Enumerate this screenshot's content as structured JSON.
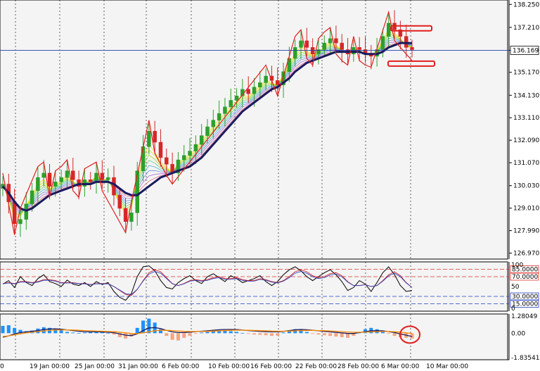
{
  "colors": {
    "background": "#ffffff",
    "pane": "#f4f4f4",
    "grid": "#000000",
    "axis": "#000000",
    "candle_up": "#2ca02c",
    "candle_down": "#d62728",
    "zigzag": "#e0201e",
    "main_ma": "#1a1a5e",
    "price_line": "#1f3fa8",
    "price_label_bg": "#ffffff",
    "stoch_main": "#000000",
    "stoch_signal_a": "#d0202a",
    "stoch_signal_b": "#2040c0",
    "level_red": "#e03030",
    "level_blue": "#2040c0",
    "macd_pos": "#1e90ff",
    "macd_neg": "#f4a582",
    "macd_line": "#1a1a5e",
    "macd_signal": "#ff8c00",
    "annotation": "#e0201e"
  },
  "chart_data": [
    {
      "type": "line",
      "panel": "price",
      "y_ticks": [
        "138.250",
        "137.210",
        "136.169",
        "135.170",
        "134.130",
        "133.110",
        "132.090",
        "131.070",
        "130.030",
        "129.010",
        "127.990",
        "126.970"
      ],
      "current_price": "136.169",
      "ylim": [
        126.7,
        138.45
      ],
      "x_labels": [
        "0",
        "19 Jan 00:00",
        "25 Jan 00:00",
        "31 Jan 00:00",
        "6 Feb 00:00",
        "10 Feb 00:00",
        "16 Feb 00:00",
        "22 Feb 00:00",
        "28 Feb 00:00",
        "6 Mar 00:00",
        "10 Mar 00:00"
      ],
      "x_label_positions": [
        0,
        42,
        106,
        168,
        230,
        296,
        356,
        420,
        480,
        542,
        606
      ],
      "close": [
        130.1,
        129.3,
        128.3,
        128.5,
        129.2,
        129.8,
        130.4,
        130.6,
        130.0,
        130.2,
        130.4,
        130.7,
        130.3,
        130.0,
        130.3,
        130.2,
        130.6,
        130.3,
        130.4,
        129.6,
        129.0,
        128.4,
        128.8,
        130.7,
        131.8,
        132.5,
        132.0,
        131.3,
        131.0,
        130.6,
        131.2,
        131.4,
        131.6,
        131.9,
        132.3,
        132.7,
        133.0,
        133.3,
        133.6,
        133.9,
        134.1,
        134.4,
        134.2,
        134.5,
        134.7,
        135.0,
        134.8,
        134.6,
        135.2,
        135.8,
        136.3,
        136.6,
        136.3,
        136.0,
        136.2,
        136.5,
        136.7,
        136.5,
        136.2,
        136.0,
        136.3,
        136.2,
        136.0,
        135.9,
        136.2,
        136.8,
        137.4,
        137.1,
        136.8,
        136.3,
        136.2
      ],
      "series": [
        {
          "name": "",
          "role": "ma-slow",
          "values": [
            130.0,
            129.7,
            129.3,
            129.0,
            128.9,
            129.0,
            129.2,
            129.4,
            129.6,
            129.7,
            129.8,
            129.9,
            130.0,
            130.1,
            130.1,
            130.1,
            130.2,
            130.2,
            130.2,
            130.1,
            129.9,
            129.7,
            129.6,
            129.6,
            129.8,
            130.0,
            130.2,
            130.4,
            130.5,
            130.6,
            130.7,
            130.8,
            130.9,
            131.1,
            131.3,
            131.6,
            131.9,
            132.2,
            132.5,
            132.8,
            133.1,
            133.4,
            133.6,
            133.8,
            134.0,
            134.2,
            134.4,
            134.5,
            134.7,
            134.9,
            135.2,
            135.4,
            135.6,
            135.7,
            135.8,
            135.9,
            136.0,
            136.1,
            136.1,
            136.1,
            136.1,
            136.1,
            136.0,
            136.0,
            136.0,
            136.1,
            136.3,
            136.4,
            136.5,
            136.5,
            136.5
          ]
        }
      ]
    },
    {
      "type": "line",
      "panel": "stochastic",
      "ylim": [
        0,
        100
      ],
      "y_ticks": [
        "100",
        "50",
        "0"
      ],
      "levels": [
        {
          "label": "85.0000",
          "value": 85,
          "color": "red"
        },
        {
          "label": "70.0000",
          "value": 70,
          "color": "red"
        },
        {
          "label": "30.0000",
          "value": 30,
          "color": "blue"
        },
        {
          "label": "15.0000",
          "value": 15,
          "color": "blue"
        }
      ],
      "series": [
        {
          "name": "",
          "role": "stoch-main",
          "values": [
            55,
            62,
            48,
            70,
            58,
            52,
            66,
            74,
            60,
            56,
            50,
            63,
            55,
            52,
            58,
            50,
            60,
            54,
            58,
            40,
            28,
            22,
            36,
            70,
            90,
            92,
            82,
            62,
            48,
            45,
            58,
            66,
            72,
            62,
            56,
            70,
            76,
            68,
            60,
            72,
            66,
            58,
            62,
            66,
            72,
            60,
            52,
            60,
            74,
            84,
            90,
            82,
            70,
            62,
            70,
            78,
            84,
            74,
            60,
            42,
            48,
            62,
            55,
            40,
            58,
            78,
            90,
            74,
            52,
            40,
            42
          ]
        },
        {
          "name": "",
          "role": "stoch-signal",
          "values": [
            56,
            58,
            56,
            60,
            60,
            58,
            60,
            64,
            64,
            62,
            58,
            58,
            58,
            56,
            56,
            54,
            56,
            56,
            56,
            50,
            42,
            34,
            32,
            44,
            62,
            78,
            84,
            80,
            68,
            56,
            52,
            56,
            62,
            64,
            62,
            64,
            68,
            70,
            66,
            66,
            68,
            64,
            62,
            62,
            66,
            64,
            60,
            58,
            62,
            70,
            80,
            84,
            80,
            72,
            68,
            70,
            76,
            78,
            72,
            60,
            52,
            52,
            54,
            50,
            52,
            62,
            74,
            80,
            72,
            58,
            48
          ]
        }
      ]
    },
    {
      "type": "bar",
      "panel": "macd",
      "ylim": [
        -2.0,
        1.45
      ],
      "y_ticks": [
        "1.28049",
        "0.00",
        "-1.83541"
      ],
      "histogram": [
        0.55,
        0.6,
        0.4,
        0.25,
        0.15,
        0.2,
        0.35,
        0.45,
        0.4,
        0.35,
        0.25,
        0.1,
        0.05,
        0.02,
        0.05,
        0.08,
        0.1,
        0.06,
        0.02,
        -0.1,
        -0.3,
        -0.4,
        -0.25,
        0.4,
        0.95,
        1.1,
        0.8,
        0.3,
        -0.2,
        -0.5,
        -0.55,
        -0.35,
        -0.2,
        -0.05,
        0.05,
        0.1,
        0.15,
        0.2,
        0.2,
        0.15,
        0.1,
        0.02,
        -0.05,
        -0.1,
        -0.12,
        -0.15,
        -0.2,
        -0.18,
        0.05,
        0.2,
        0.3,
        0.25,
        0.1,
        -0.05,
        -0.1,
        -0.15,
        -0.2,
        -0.25,
        -0.3,
        -0.35,
        -0.2,
        0.1,
        0.3,
        0.4,
        0.3,
        0.1,
        -0.05,
        -0.2,
        -0.3,
        -0.35,
        -0.4
      ],
      "series": [
        {
          "name": "",
          "role": "macd-line",
          "values": [
            -0.3,
            -0.2,
            -0.05,
            0.05,
            0.1,
            0.15,
            0.2,
            0.28,
            0.32,
            0.33,
            0.3,
            0.25,
            0.2,
            0.15,
            0.12,
            0.1,
            0.1,
            0.09,
            0.08,
            0.04,
            -0.05,
            -0.15,
            -0.18,
            -0.05,
            0.2,
            0.4,
            0.42,
            0.35,
            0.22,
            0.1,
            0.05,
            0.05,
            0.08,
            0.12,
            0.15,
            0.18,
            0.22,
            0.26,
            0.28,
            0.28,
            0.27,
            0.24,
            0.2,
            0.17,
            0.14,
            0.12,
            0.1,
            0.1,
            0.14,
            0.2,
            0.26,
            0.28,
            0.26,
            0.22,
            0.18,
            0.14,
            0.1,
            0.06,
            0.02,
            -0.02,
            -0.02,
            0.05,
            0.12,
            0.18,
            0.2,
            0.18,
            0.12,
            0.05,
            -0.05,
            -0.15,
            -0.25
          ]
        },
        {
          "name": "",
          "role": "macd-signal",
          "values": [
            -0.25,
            -0.2,
            -0.12,
            -0.05,
            0.02,
            0.07,
            0.12,
            0.17,
            0.21,
            0.24,
            0.25,
            0.25,
            0.24,
            0.22,
            0.2,
            0.18,
            0.16,
            0.15,
            0.13,
            0.11,
            0.08,
            0.03,
            -0.02,
            -0.03,
            0.03,
            0.11,
            0.18,
            0.22,
            0.22,
            0.2,
            0.17,
            0.14,
            0.13,
            0.13,
            0.13,
            0.14,
            0.16,
            0.18,
            0.2,
            0.22,
            0.23,
            0.23,
            0.22,
            0.21,
            0.19,
            0.18,
            0.16,
            0.15,
            0.15,
            0.16,
            0.18,
            0.2,
            0.21,
            0.21,
            0.2,
            0.19,
            0.17,
            0.15,
            0.12,
            0.09,
            0.07,
            0.07,
            0.08,
            0.1,
            0.12,
            0.13,
            0.13,
            0.11,
            0.08,
            0.03,
            -0.03
          ]
        }
      ]
    }
  ]
}
